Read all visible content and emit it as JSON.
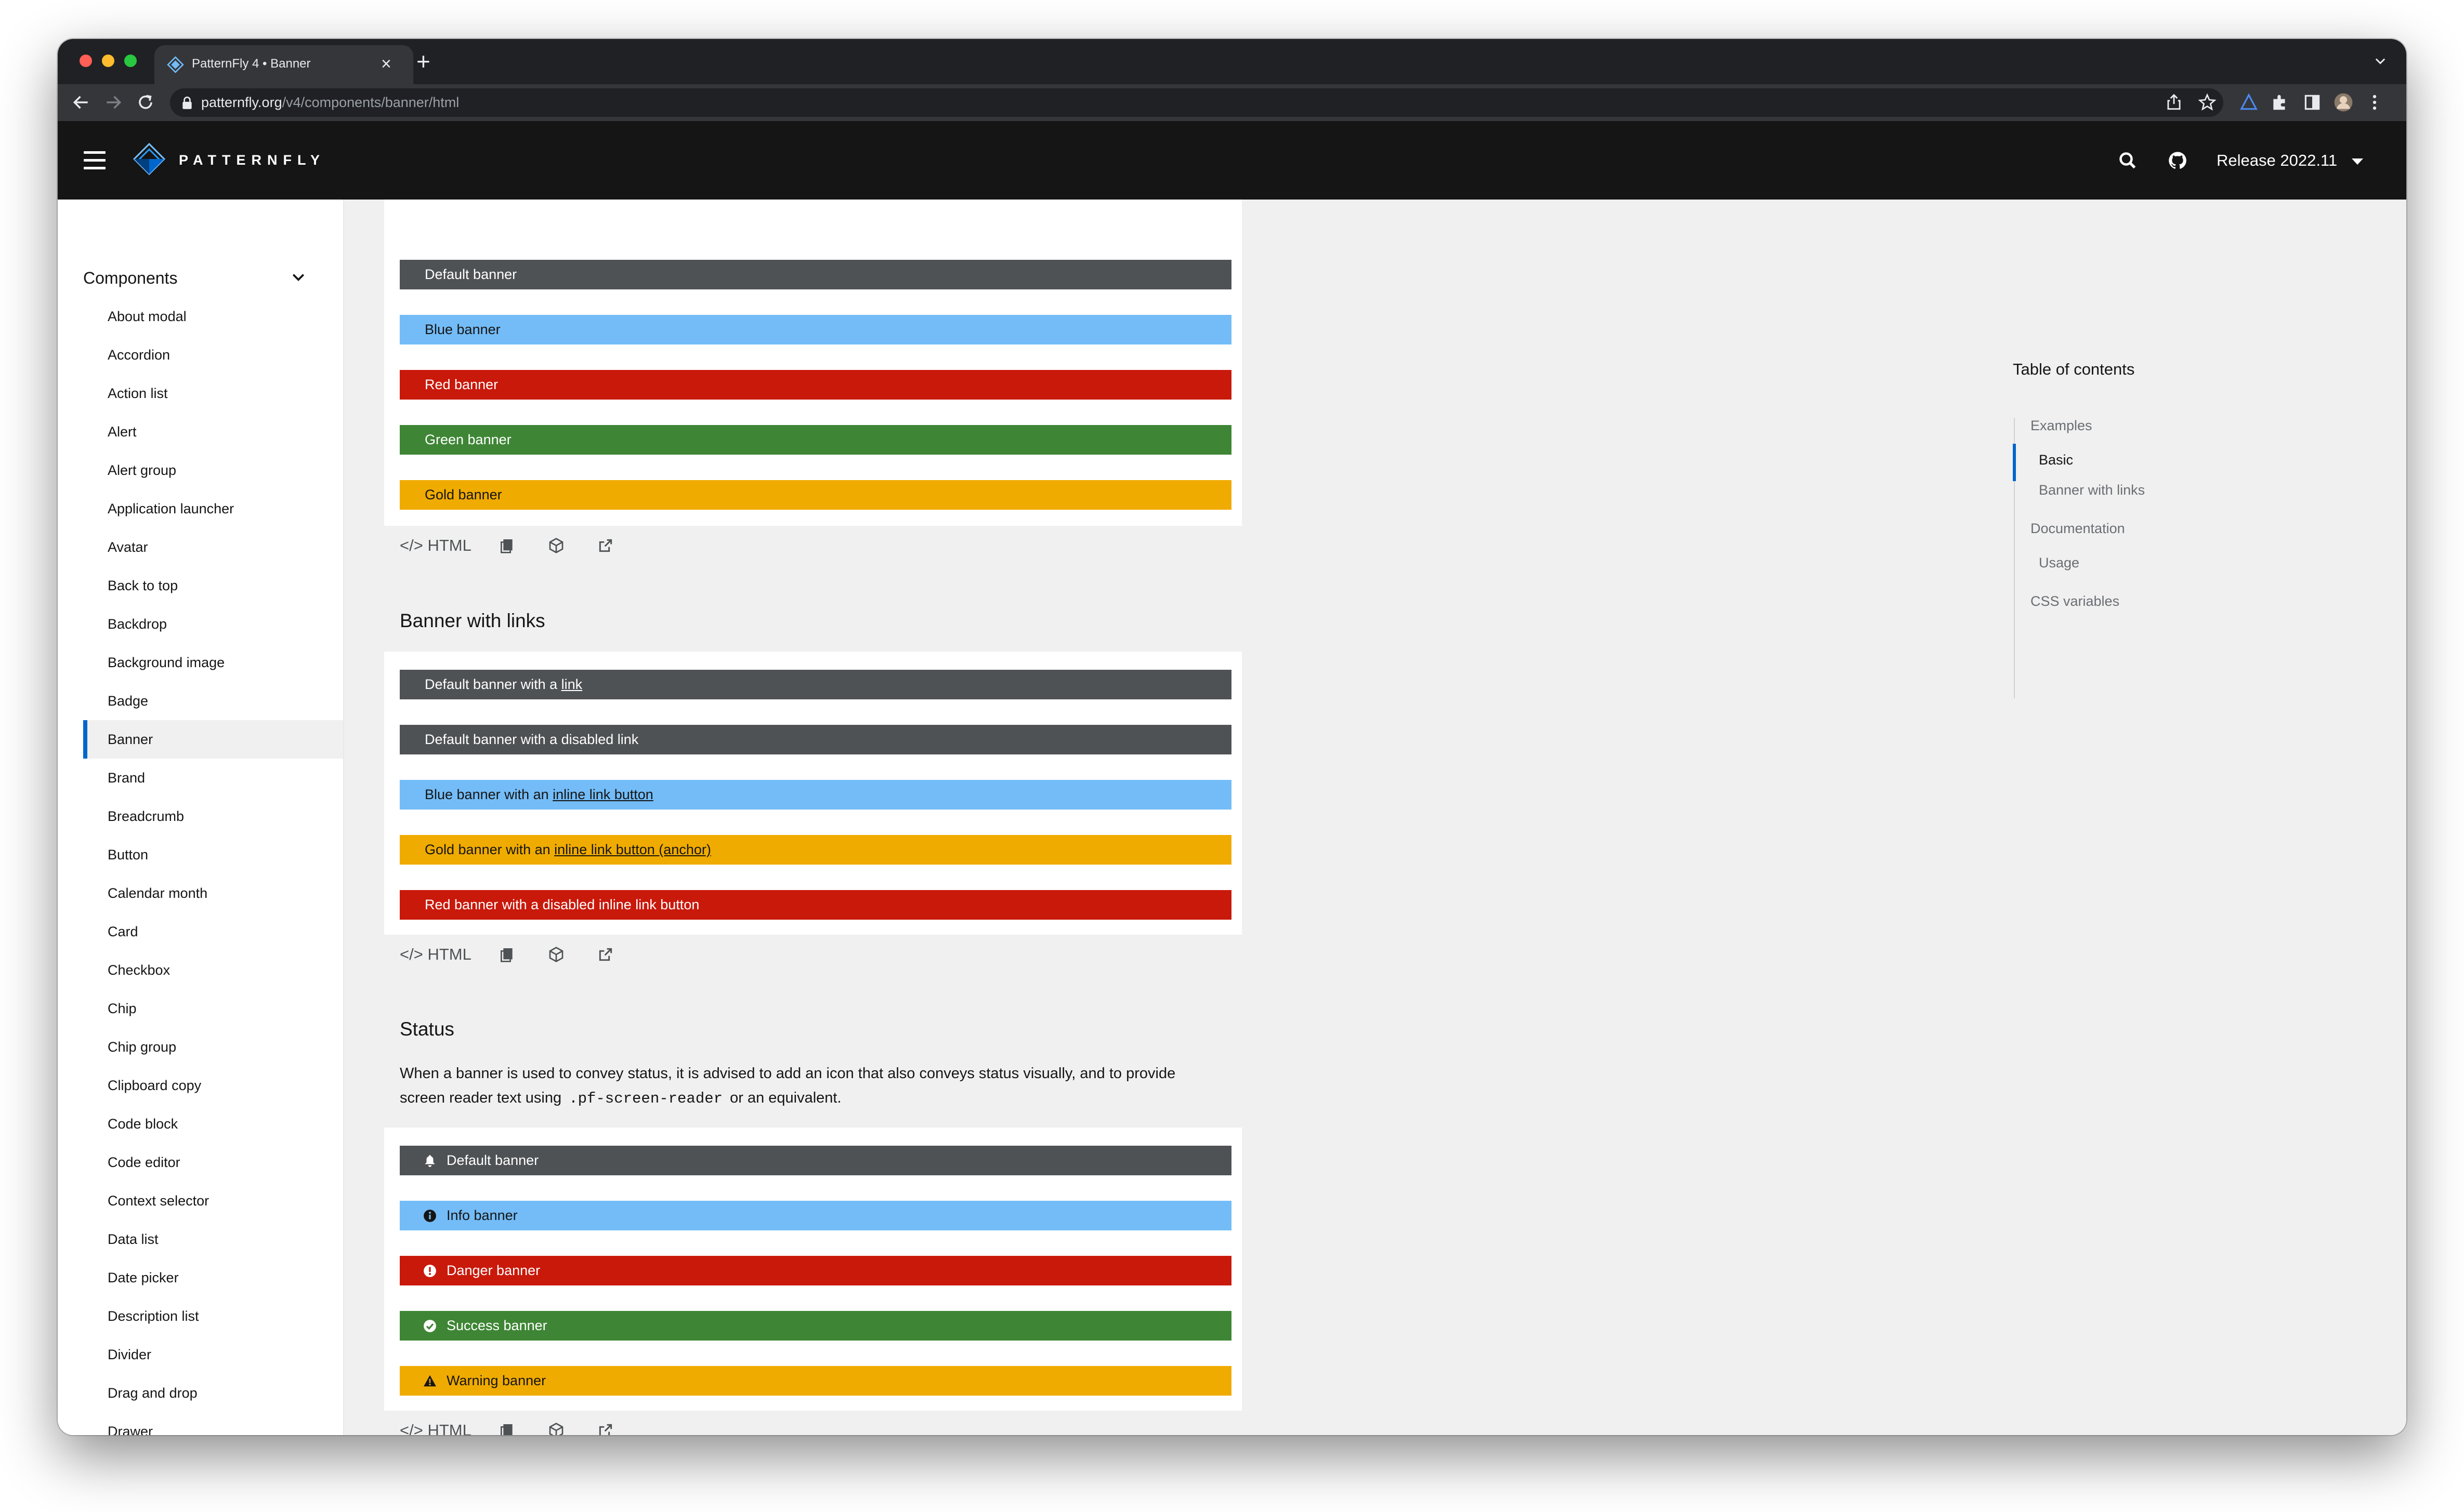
{
  "browser": {
    "tab_title": "PatternFly 4 • Banner",
    "url_host": "patternfly.org",
    "url_path": "/v4/components/banner/html"
  },
  "masthead": {
    "brand": "PATTERNFLY",
    "release": "Release 2022.11"
  },
  "sidebar": {
    "title": "Components",
    "active": "Banner",
    "items": [
      "About modal",
      "Accordion",
      "Action list",
      "Alert",
      "Alert group",
      "Application launcher",
      "Avatar",
      "Back to top",
      "Backdrop",
      "Background image",
      "Badge",
      "Banner",
      "Brand",
      "Breadcrumb",
      "Button",
      "Calendar month",
      "Card",
      "Checkbox",
      "Chip",
      "Chip group",
      "Clipboard copy",
      "Code block",
      "Code editor",
      "Context selector",
      "Data list",
      "Date picker",
      "Description list",
      "Divider",
      "Drag and drop",
      "Drawer"
    ]
  },
  "basic": {
    "banners": [
      {
        "text": "Default banner",
        "variant": "default"
      },
      {
        "text": "Blue banner",
        "variant": "blue"
      },
      {
        "text": "Red banner",
        "variant": "red"
      },
      {
        "text": "Green banner",
        "variant": "green"
      },
      {
        "text": "Gold banner",
        "variant": "gold"
      }
    ]
  },
  "links_section": {
    "heading": "Banner with links",
    "b1_pre": "Default banner with a ",
    "b1_link": "link",
    "b2": "Default banner with a disabled link",
    "b3_pre": "Blue banner with an ",
    "b3_link": "inline link button",
    "b4_pre": "Gold banner with an ",
    "b4_link": "inline link button (anchor)",
    "b5": "Red banner with a disabled inline link button"
  },
  "status_section": {
    "heading": "Status",
    "para_1": "When a banner is used to convey status, it is advised to add an icon that also conveys status visually, and to provide screen reader text using",
    "para_code": ".pf-screen-reader",
    "para_2": "or an equivalent.",
    "banners": [
      {
        "text": "Default banner",
        "icon": "bell-icon"
      },
      {
        "text": "Info banner",
        "icon": "info-circle-icon"
      },
      {
        "text": "Danger banner",
        "icon": "exclamation-circle-icon"
      },
      {
        "text": "Success banner",
        "icon": "check-circle-icon"
      },
      {
        "text": "Warning banner",
        "icon": "exclamation-triangle-icon"
      }
    ]
  },
  "code_toolbar": {
    "html_label": "HTML"
  },
  "toc": {
    "title": "Table of contents",
    "examples": "Examples",
    "basic": "Basic",
    "banner_with_links": "Banner with links",
    "documentation": "Documentation",
    "usage": "Usage",
    "css_variables": "CSS variables"
  },
  "colors": {
    "default": "#4f5255",
    "blue": "#73bcf7",
    "red": "#c9190b",
    "green": "#3e8635",
    "gold": "#f0ab00",
    "accent": "#0066cc"
  }
}
